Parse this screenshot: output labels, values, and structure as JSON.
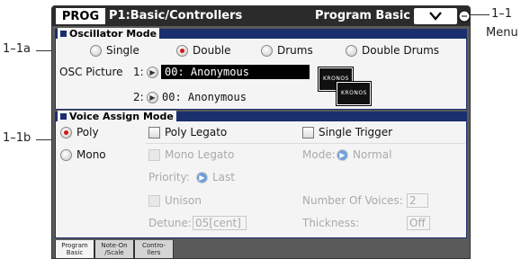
{
  "header": {
    "mode": "PROG",
    "page_name": "P1:Basic/Controllers",
    "page_sub": "Program Basic",
    "menu_icon": "chevron-down-icon"
  },
  "callouts": {
    "c1_1": "1–1",
    "menu": "Menu",
    "c1_1a": "1–1a",
    "c1_1b": "1–1b"
  },
  "oscillator": {
    "title": "Oscillator Mode",
    "options": [
      "Single",
      "Double",
      "Drums",
      "Double Drums"
    ],
    "selected": "Double",
    "osc_picture_label": "OSC Picture",
    "osc1_label": "1:",
    "osc1_value": "00: Anonymous",
    "osc2_label": "2:",
    "osc2_value": "00: Anonymous",
    "thumb_text": "KRONOS"
  },
  "voice": {
    "title": "Voice Assign Mode",
    "poly_label": "Poly",
    "mono_label": "Mono",
    "selected": "Poly",
    "poly_legato": "Poly Legato",
    "single_trigger": "Single Trigger",
    "mono_legato": "Mono Legato",
    "mode_label": "Mode:",
    "mode_value": "Normal",
    "priority_label": "Priority:",
    "priority_value": "Last",
    "unison": "Unison",
    "num_voices_label": "Number Of Voices:",
    "num_voices_value": "2",
    "detune_label": "Detune:",
    "detune_value": "05[cent]",
    "thickness_label": "Thickness:",
    "thickness_value": "Off"
  },
  "tabs": [
    {
      "line1": "Program",
      "line2": "Basic"
    },
    {
      "line1": "Note-On",
      "line2": "/Scale"
    },
    {
      "line1": "Contro-",
      "line2": "llers"
    }
  ]
}
